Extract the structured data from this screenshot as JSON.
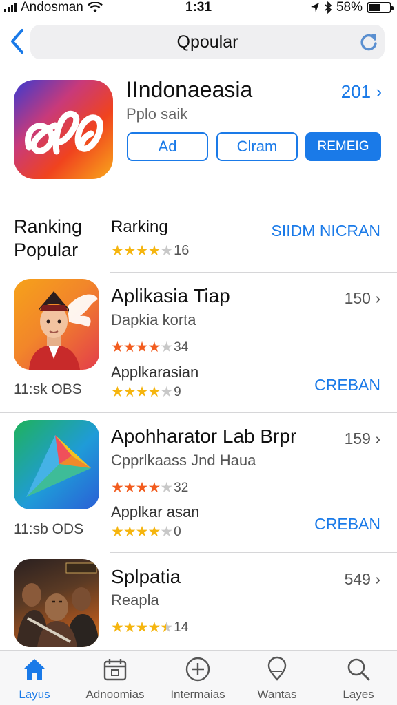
{
  "status_bar": {
    "carrier": "Andosman",
    "time": "1:31",
    "battery": "58%",
    "battery_level": 0.58
  },
  "search": {
    "query": "Qpoular"
  },
  "featured": {
    "title": "IIndonaeasia",
    "subtitle": "Pplo saik",
    "count": "201 ›",
    "buttons": {
      "ad": "Ad",
      "claim": "Clram",
      "primary": "REMEIG"
    }
  },
  "ranking": {
    "heading_line1": "Ranking",
    "heading_line2": "Popular",
    "subheading": "Rarking",
    "rating_count": "16",
    "rating": 4,
    "link": "SIIDM NICRAN"
  },
  "apps": [
    {
      "title": "Aplikasia Tiap",
      "subtitle": "Dapkia korta",
      "count": "150 ›",
      "rating_count": "34",
      "rating": 4,
      "section_label": "Applkarasian",
      "section_rating_count": "9",
      "section_rating": 4,
      "left_caption": "11:sk OBS",
      "link": "CREBAN"
    },
    {
      "title": "Apohharator Lab Brpr",
      "subtitle": "Cpprlkaass Jnd Haua",
      "count": "159 ›",
      "rating_count": "32",
      "rating": 4,
      "section_label": "Applkar asan",
      "section_rating_count": "0",
      "section_rating": 4,
      "left_caption": "11:sb ODS",
      "link": "CREBAN"
    },
    {
      "title": "Splpatia",
      "subtitle": "Reapla",
      "count": "549 ›",
      "rating_count": "14",
      "rating": 4.5
    }
  ],
  "tabs": [
    {
      "label": "Layus",
      "icon": "home-icon",
      "active": true
    },
    {
      "label": "Adnoomias",
      "icon": "calendar-icon",
      "active": false
    },
    {
      "label": "Intermaias",
      "icon": "plus-circle-icon",
      "active": false
    },
    {
      "label": "Wantas",
      "icon": "location-icon",
      "active": false
    },
    {
      "label": "Layes",
      "icon": "search-icon",
      "active": false
    }
  ],
  "colors": {
    "accent": "#1a7ae8",
    "star": "#f5b50f",
    "star_alt": "#f25c1e"
  }
}
